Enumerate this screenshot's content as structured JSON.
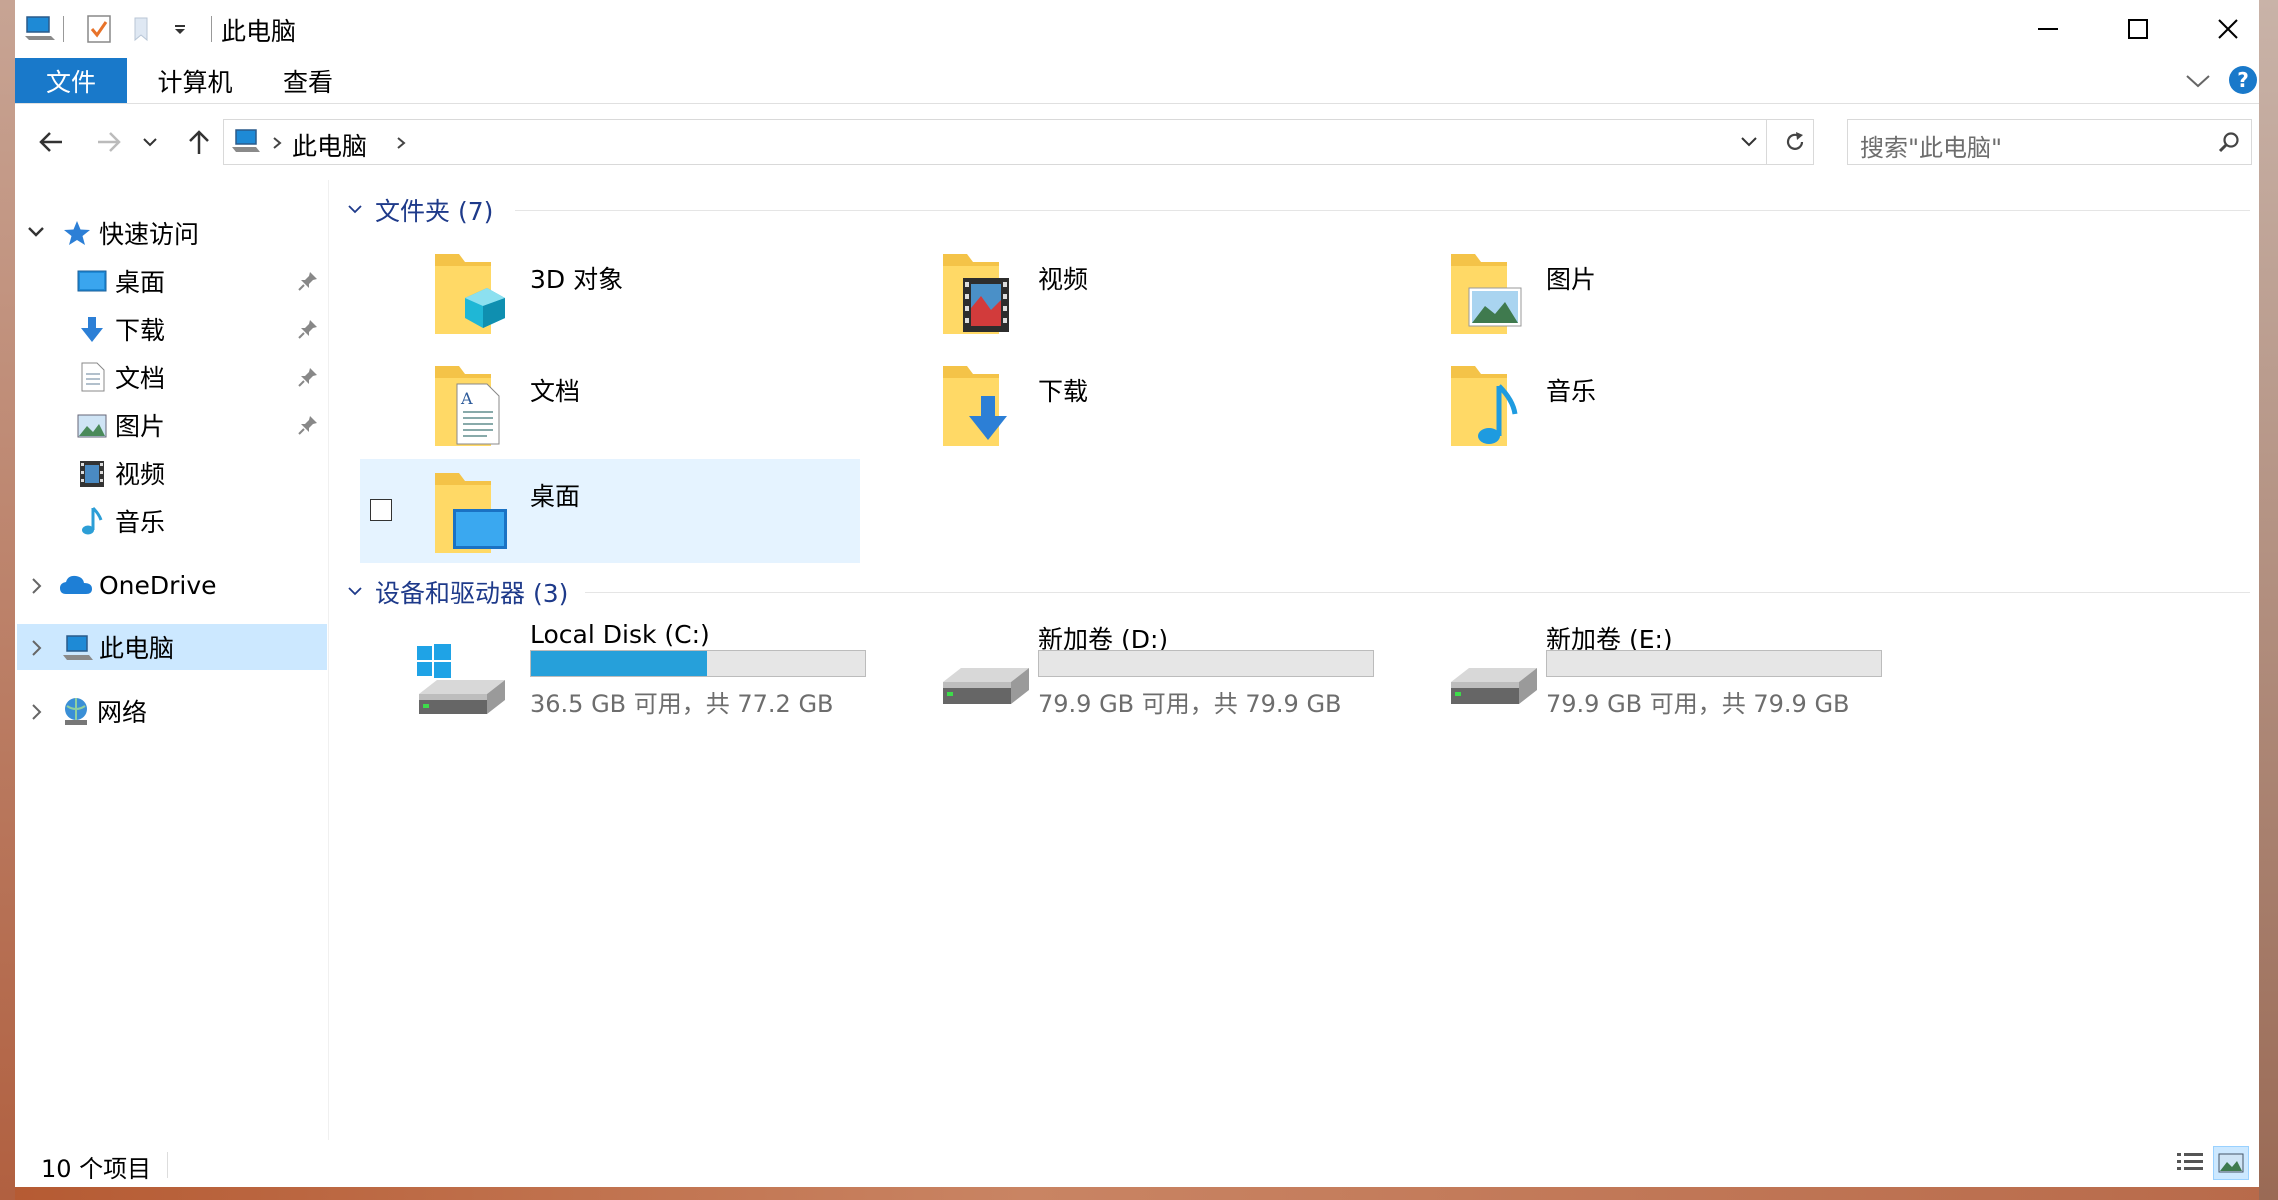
{
  "window": {
    "title": "此电脑"
  },
  "window_controls": {
    "minimize": "—",
    "maximize": "☐",
    "close": "✕"
  },
  "ribbon": {
    "tabs": [
      {
        "label": "文件",
        "active": true
      },
      {
        "label": "计算机",
        "active": false
      },
      {
        "label": "查看",
        "active": false
      }
    ],
    "help": "?"
  },
  "address": {
    "path": [
      "此电脑"
    ],
    "search_placeholder": "搜索\"此电脑\""
  },
  "sidebar": {
    "quick_access": {
      "label": "快速访问",
      "expanded": true
    },
    "quick_items": [
      {
        "label": "桌面",
        "icon": "desktop-icon",
        "pinned": true
      },
      {
        "label": "下载",
        "icon": "download-icon",
        "pinned": true
      },
      {
        "label": "文档",
        "icon": "document-icon",
        "pinned": true
      },
      {
        "label": "图片",
        "icon": "picture-icon",
        "pinned": true
      },
      {
        "label": "视频",
        "icon": "video-icon",
        "pinned": false
      },
      {
        "label": "音乐",
        "icon": "music-icon",
        "pinned": false
      }
    ],
    "onedrive": {
      "label": "OneDrive"
    },
    "this_pc": {
      "label": "此电脑",
      "selected": true
    },
    "network": {
      "label": "网络"
    }
  },
  "content": {
    "folders_section": {
      "title": "文件夹 (7)"
    },
    "folders": [
      {
        "name": "3D 对象",
        "icon": "folder-3d-objects-icon"
      },
      {
        "name": "视频",
        "icon": "folder-videos-icon"
      },
      {
        "name": "图片",
        "icon": "folder-pictures-icon"
      },
      {
        "name": "文档",
        "icon": "folder-documents-icon"
      },
      {
        "name": "下载",
        "icon": "folder-downloads-icon"
      },
      {
        "name": "音乐",
        "icon": "folder-music-icon"
      },
      {
        "name": "桌面",
        "icon": "folder-desktop-icon",
        "highlighted": true
      }
    ],
    "drives_section": {
      "title": "设备和驱动器 (3)"
    },
    "drives": [
      {
        "name": "Local Disk (C:)",
        "caption": "36.5 GB 可用，共 77.2 GB",
        "free_gb": 36.5,
        "total_gb": 77.2,
        "icon": "system-drive-icon"
      },
      {
        "name": "新加卷 (D:)",
        "caption": "79.9 GB 可用，共 79.9 GB",
        "free_gb": 79.9,
        "total_gb": 79.9,
        "icon": "drive-icon"
      },
      {
        "name": "新加卷 (E:)",
        "caption": "79.9 GB 可用，共 79.9 GB",
        "free_gb": 79.9,
        "total_gb": 79.9,
        "icon": "drive-icon"
      }
    ]
  },
  "status": {
    "items_count": "10 个项目"
  },
  "colors": {
    "accent": "#0063b1",
    "selection": "#cce8ff",
    "hover": "#e5f3ff",
    "bar_fill": "#26a0da",
    "section_title": "#1e3a8a"
  }
}
